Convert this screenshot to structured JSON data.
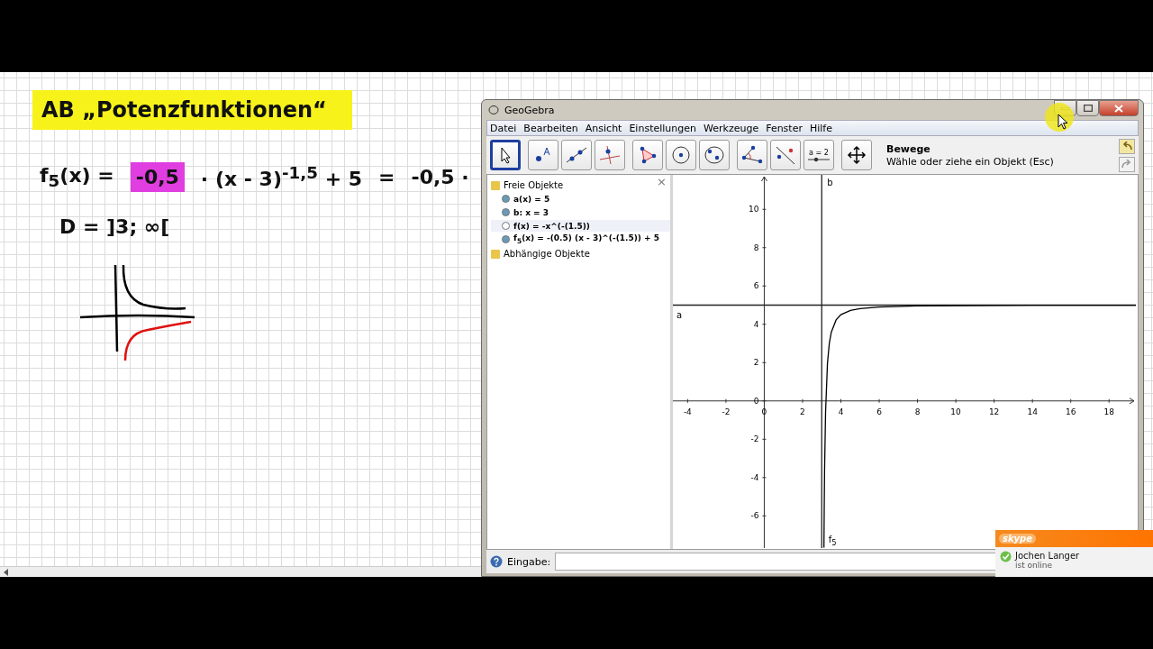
{
  "notes": {
    "title": "AB „Potenzfunktionen“",
    "equation": [
      {
        "text": "f$_{5}$(x) ="
      },
      {
        "text": "-0,5",
        "color": "#e03ee0"
      },
      {
        "text": "· (x - 3)$^{-1,5}$ + 5"
      },
      {
        "text": "="
      },
      {
        "text": "-0,5 ·"
      }
    ],
    "domain": "D = ]3; ∞["
  },
  "geogebra": {
    "title": "GeoGebra",
    "menu": [
      "Datei",
      "Bearbeiten",
      "Ansicht",
      "Einstellungen",
      "Werkzeuge",
      "Fenster",
      "Hilfe"
    ],
    "tool_groups": [
      [
        {
          "kind": "move",
          "selected": true
        }
      ],
      [
        {
          "kind": "point",
          "selected": false
        },
        {
          "kind": "line",
          "selected": false
        },
        {
          "kind": "perpendicular",
          "selected": false
        }
      ],
      [
        {
          "kind": "polygon",
          "selected": false
        },
        {
          "kind": "circle",
          "selected": false
        },
        {
          "kind": "conic",
          "selected": false
        }
      ],
      [
        {
          "kind": "angle",
          "selected": false
        },
        {
          "kind": "reflect",
          "selected": false
        },
        {
          "kind": "slider",
          "label": "a = 2",
          "selected": false
        }
      ],
      [
        {
          "kind": "move_view",
          "selected": false
        }
      ]
    ],
    "tool_name": "Bewege",
    "tool_help": "Wähle oder ziehe ein Objekt (Esc)",
    "algebra": {
      "close": "×",
      "folders": [
        {
          "label": "Freie Objekte",
          "children": [
            {
              "text": "a(x) = 5",
              "visible": true,
              "selected": false
            },
            {
              "text": "b: x = 3",
              "visible": true,
              "selected": false
            },
            {
              "text": "f(x) = -x^(-(1.5))",
              "visible": false,
              "selected": true
            },
            {
              "text": "f$_{5}$(x) = -(0.5) (x - 3)^(-(1.5)) + 5",
              "visible": true,
              "selected": false
            }
          ]
        },
        {
          "label": "Abhängige Objekte"
        }
      ]
    },
    "graphics": {
      "chart_data": {
        "type": "line",
        "x": [
          3.116,
          3.13,
          3.15,
          3.2,
          3.3,
          3.4,
          3.5,
          3.75,
          4,
          4.5,
          5,
          6,
          8,
          10,
          14,
          19.4
        ],
        "series": [
          {
            "name": "f$_{5}$",
            "color": "#000000",
            "values": [
              -7.65,
              -5.67,
              -3.61,
              -0.59,
              1.96,
              3.02,
              3.59,
              4.23,
              4.5,
              4.73,
              4.82,
              4.9,
              4.96,
              4.97,
              4.99,
              4.99
            ]
          }
        ],
        "xlim": [
          -4.77,
          19.4
        ],
        "ylim": [
          -7.68,
          11.8
        ],
        "xticks": [
          -4,
          -2,
          0,
          2,
          4,
          6,
          8,
          10,
          12,
          14,
          16,
          18
        ],
        "yticks": [
          -6,
          -4,
          -2,
          0,
          2,
          4,
          6,
          8,
          10
        ],
        "ref_lines": [
          {
            "axis": "y",
            "value": 5
          },
          {
            "axis": "x",
            "value": 3
          }
        ],
        "annotations": [
          "a",
          "b"
        ]
      }
    },
    "input": {
      "label": "Eingabe:"
    }
  },
  "skype": {
    "logo": "skype",
    "contact": "Jochen Langer",
    "status": "ist online"
  }
}
